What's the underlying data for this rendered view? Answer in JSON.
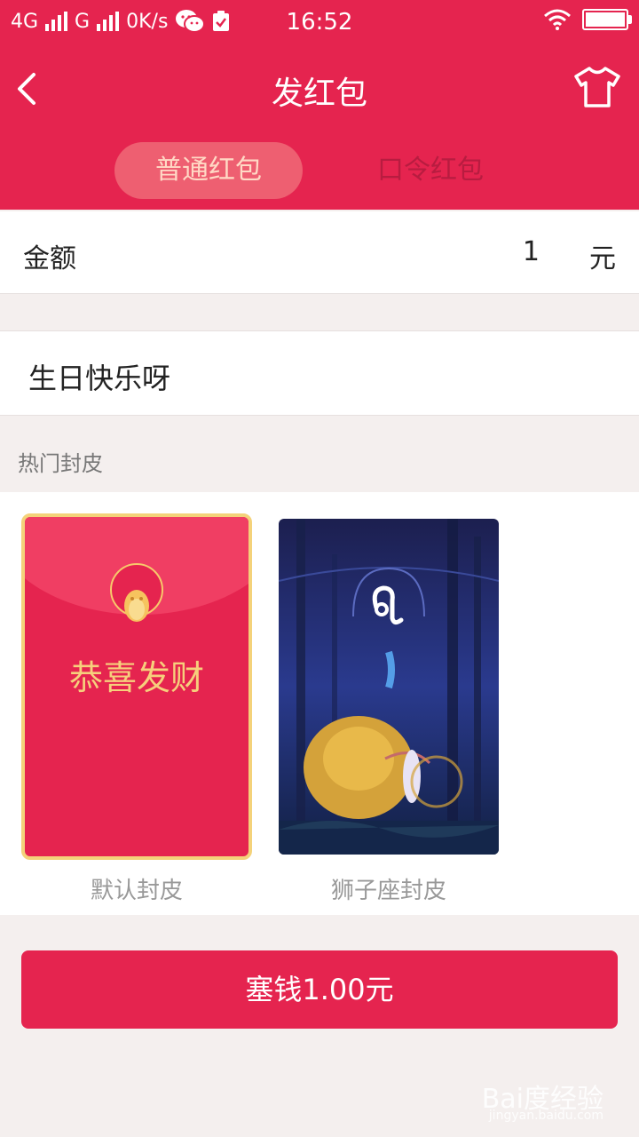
{
  "status_bar": {
    "network1": "4G",
    "network2": "G",
    "speed": "0K/s",
    "time": "16:52"
  },
  "nav": {
    "title": "发红包"
  },
  "tabs": [
    {
      "label": "普通红包",
      "active": true
    },
    {
      "label": "口令红包",
      "active": false
    }
  ],
  "amount": {
    "label": "金额",
    "value": "1",
    "unit": "元"
  },
  "message": {
    "text": "生日快乐呀"
  },
  "skins_section": {
    "title": "热门封皮",
    "items": [
      {
        "label": "默认封皮",
        "cover_text": "恭喜发财",
        "selected": true
      },
      {
        "label": "狮子座封皮",
        "selected": false
      }
    ]
  },
  "send_button": {
    "label": "塞钱1.00元"
  },
  "watermark": {
    "text": "Bai度经验",
    "sub": "jingyan.baidu.com"
  },
  "colors": {
    "brand": "#e5244f",
    "gold": "#f6cf7c"
  }
}
